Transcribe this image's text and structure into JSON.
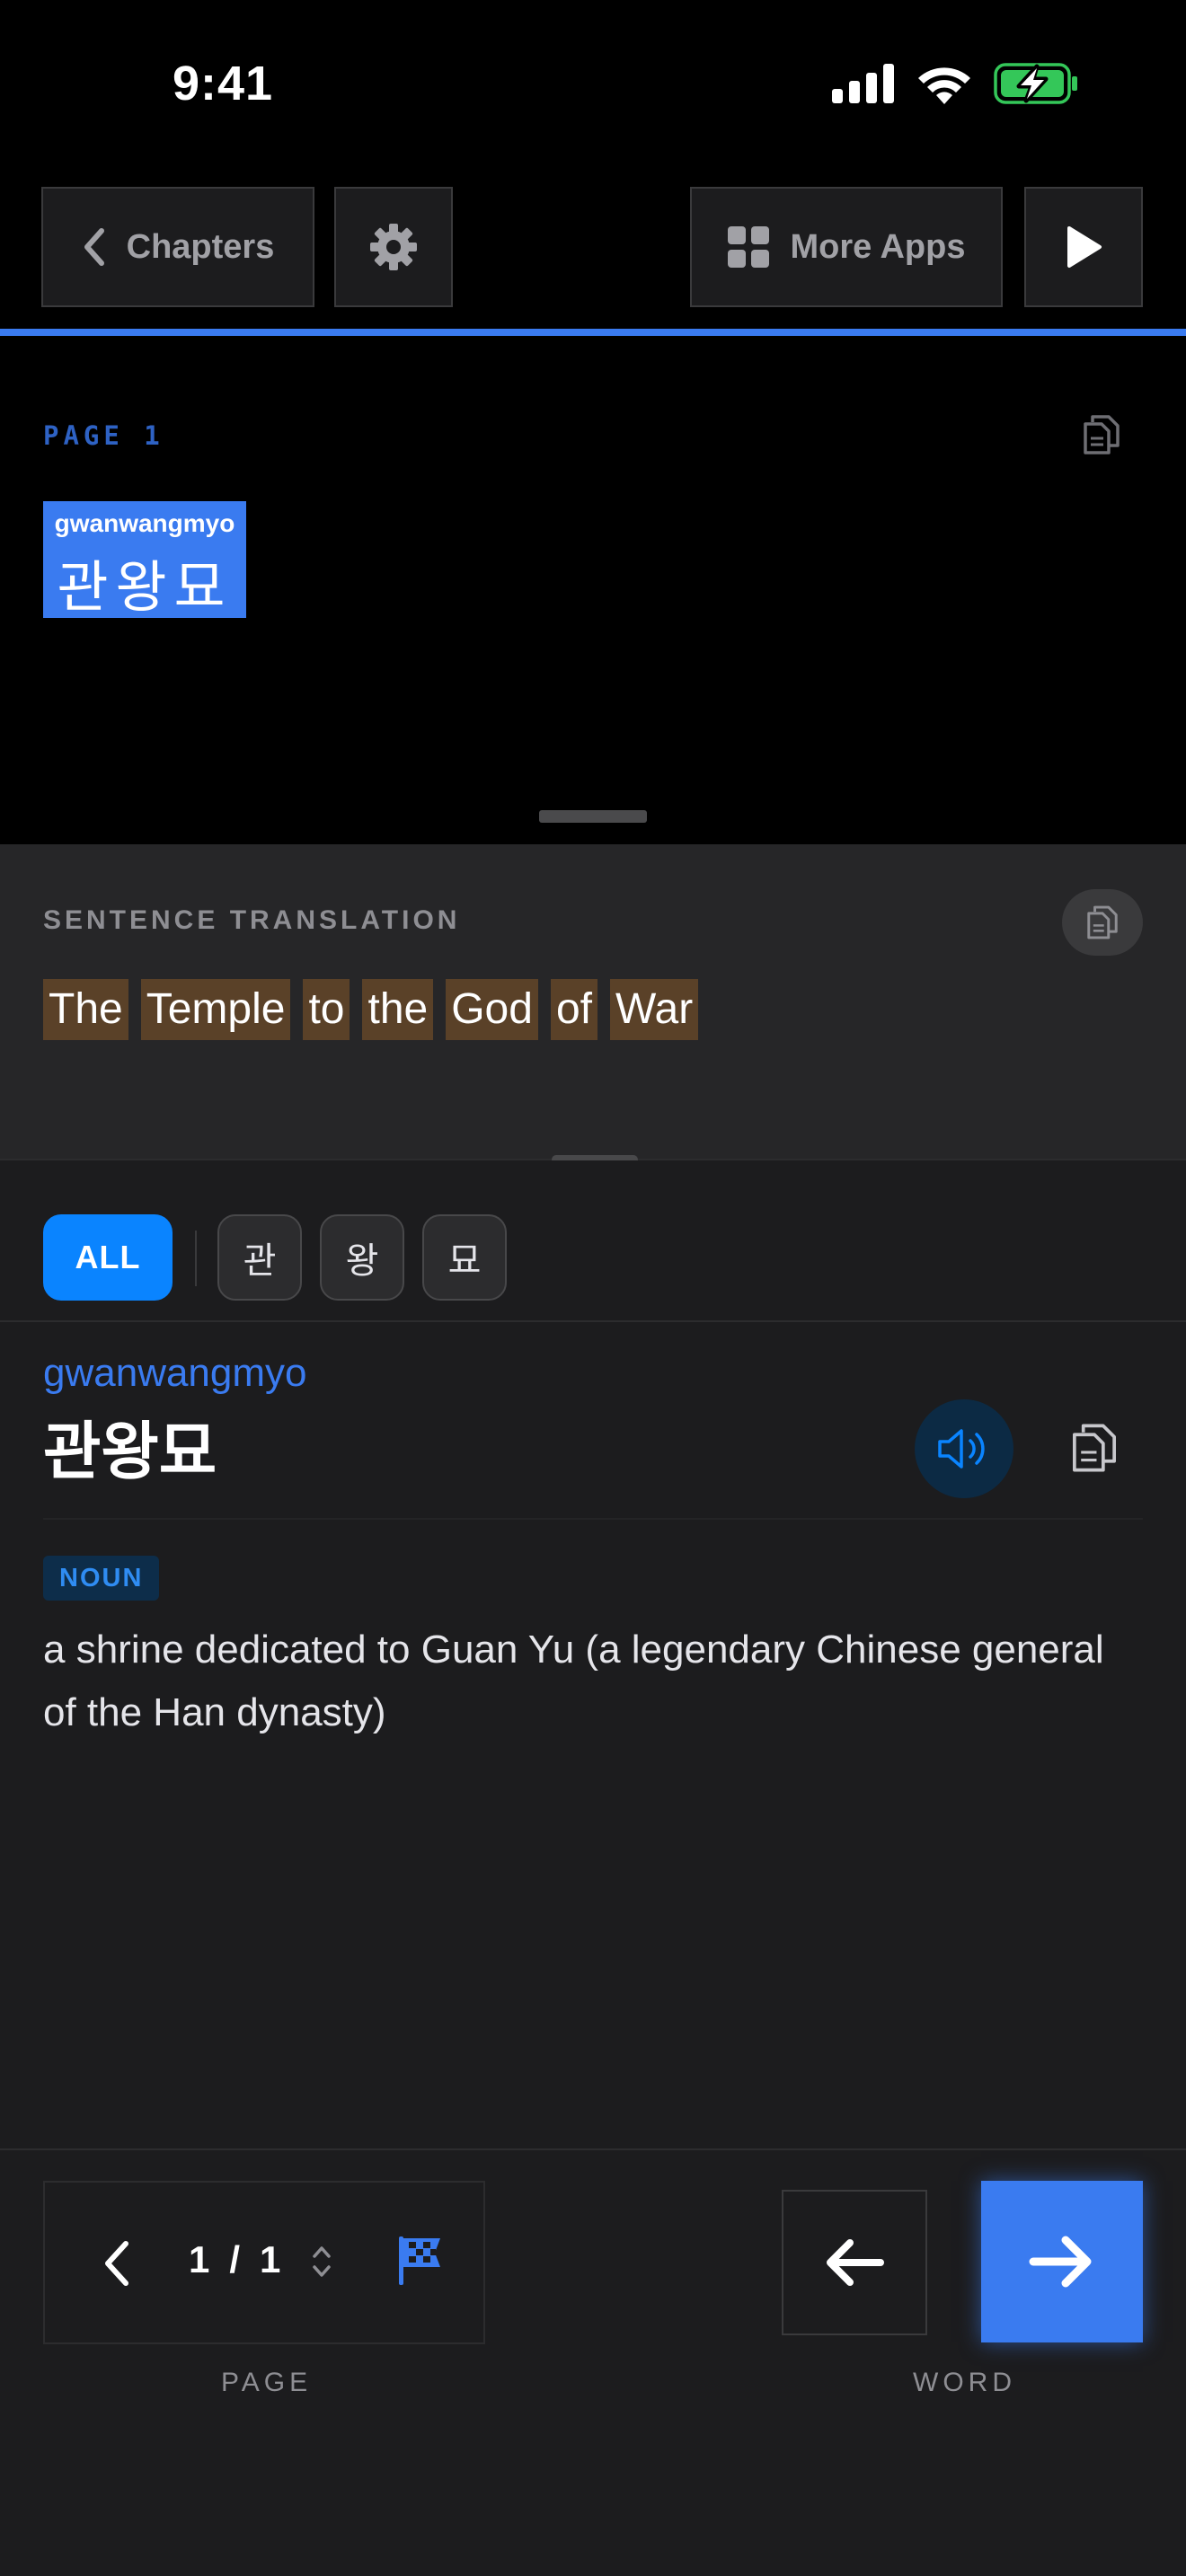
{
  "status_bar": {
    "time": "9:41"
  },
  "toolbar": {
    "chapters_label": "Chapters",
    "more_apps_label": "More Apps"
  },
  "reader": {
    "page_label": "PAGE 1",
    "word": {
      "romanization": "gwanwangmyo",
      "korean": "관왕묘"
    }
  },
  "translation": {
    "section_label": "SENTENCE TRANSLATION",
    "words": [
      "The",
      "Temple",
      "to",
      "the",
      "God",
      "of",
      "War"
    ]
  },
  "dictionary": {
    "tabs": [
      "ALL",
      "관",
      "왕",
      "묘"
    ],
    "entry": {
      "romanization": "gwanwangmyo",
      "korean": "관왕묘",
      "part_of_speech": "NOUN",
      "definition": "a shrine dedicated to Guan Yu (a legendary Chinese general of the Han dynasty)"
    }
  },
  "footer": {
    "page_current": "1",
    "page_total": "1",
    "page_label": "PAGE",
    "word_label": "WORD"
  },
  "colors": {
    "accent": "#3a7bf0",
    "tab_active": "#0a84ff",
    "translation_highlight": "#5a4128",
    "battery_green": "#34c759"
  }
}
